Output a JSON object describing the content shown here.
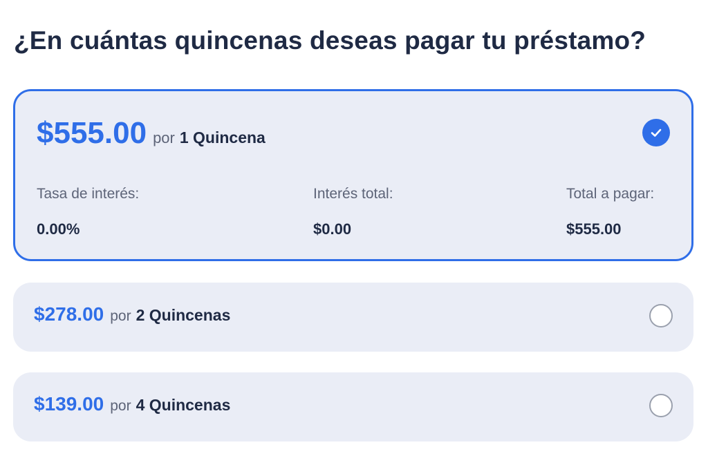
{
  "question": "¿En cuántas quincenas deseas pagar tu préstamo?",
  "selected_option": {
    "amount": "$555.00",
    "por": "por",
    "period": "1 Quincena",
    "checked_icon": "check-circle-icon",
    "stats": {
      "rate_label": "Tasa de interés:",
      "rate_value": "0.00%",
      "interest_label": "Interés total:",
      "interest_value": "$0.00",
      "total_label": "Total a pagar:",
      "total_value": "$555.00"
    }
  },
  "options": [
    {
      "amount": "$278.00",
      "por": "por",
      "period": "2 Quincenas"
    },
    {
      "amount": "$139.00",
      "por": "por",
      "period": "4 Quincenas"
    }
  ],
  "colors": {
    "accent": "#2f6ee8",
    "card_background": "#eaedf6",
    "text_dark": "#1f2a44",
    "text_muted": "#5d6478"
  }
}
